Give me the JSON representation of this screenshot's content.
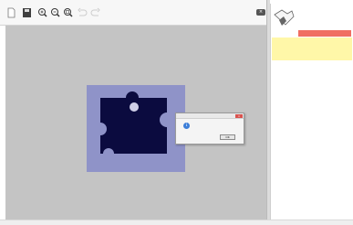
{
  "toolbar": {
    "buttons": [
      "new-file",
      "save",
      "zoom-in",
      "zoom-out",
      "zoom-fit",
      "undo",
      "redo"
    ],
    "close_label": "×"
  },
  "dialog": {
    "title": "",
    "message": "",
    "ok_label": "OK",
    "info_glyph": "i"
  },
  "panel": {
    "top_text_1": "",
    "top_text_2": "",
    "selected_text": "",
    "note_text": ""
  },
  "colors": {
    "workspace": "#c4c4c4",
    "piece_background": "#8f93c8",
    "piece": "#0b0b3f",
    "selected": "#f06e62",
    "note": "#fff7a8"
  }
}
